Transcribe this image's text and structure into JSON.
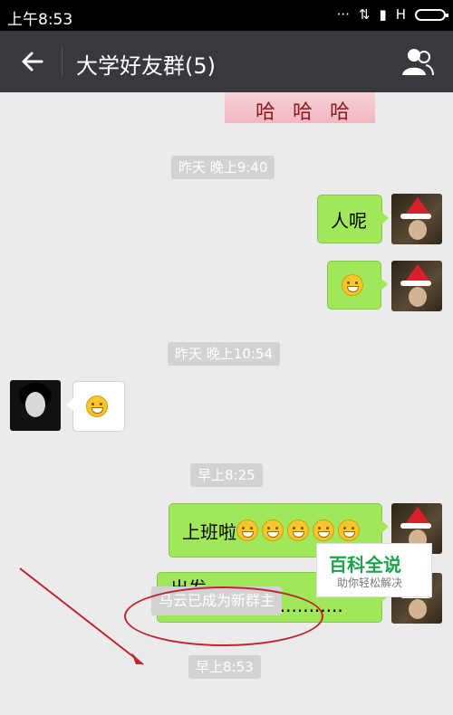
{
  "status_bar": {
    "time": "上午8:53",
    "signal_text": "H"
  },
  "header": {
    "title": "大学好友群(5)"
  },
  "previous_image": {
    "text": "哈 哈 哈"
  },
  "messages": [
    {
      "type": "time",
      "text": "昨天 晚上9:40"
    },
    {
      "type": "text",
      "sender": "me",
      "text": "人呢"
    },
    {
      "type": "emoji",
      "sender": "me",
      "text": "😁"
    },
    {
      "type": "time",
      "text": "昨天 晚上10:54"
    },
    {
      "type": "emoji",
      "sender": "other",
      "text": "🙂"
    },
    {
      "type": "time",
      "text": "早上8:25"
    },
    {
      "type": "text",
      "sender": "me",
      "text": "上班啦"
    },
    {
      "type": "text",
      "sender": "me",
      "text": "出发······························"
    },
    {
      "type": "time",
      "text": "早上8:53"
    }
  ],
  "system_message": "马云已成为新群主",
  "watermark": {
    "title": "百科全说",
    "subtitle": "助你轻松解决"
  }
}
